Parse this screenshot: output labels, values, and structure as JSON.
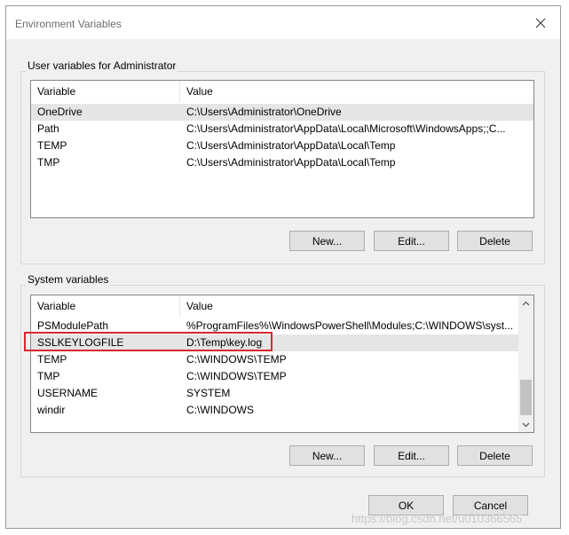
{
  "window": {
    "title": "Environment Variables"
  },
  "user_section": {
    "title": "User variables for Administrator",
    "columns": [
      "Variable",
      "Value"
    ],
    "rows": [
      [
        "OneDrive",
        "C:\\Users\\Administrator\\OneDrive"
      ],
      [
        "Path",
        "C:\\Users\\Administrator\\AppData\\Local\\Microsoft\\WindowsApps;;C..."
      ],
      [
        "TEMP",
        "C:\\Users\\Administrator\\AppData\\Local\\Temp"
      ],
      [
        "TMP",
        "C:\\Users\\Administrator\\AppData\\Local\\Temp"
      ]
    ],
    "buttons": {
      "new": "New...",
      "edit": "Edit...",
      "delete": "Delete"
    }
  },
  "system_section": {
    "title": "System variables",
    "columns": [
      "Variable",
      "Value"
    ],
    "rows": [
      [
        "PSModulePath",
        "%ProgramFiles%\\WindowsPowerShell\\Modules;C:\\WINDOWS\\syst..."
      ],
      [
        "SSLKEYLOGFILE",
        "D:\\Temp\\key.log"
      ],
      [
        "TEMP",
        "C:\\WINDOWS\\TEMP"
      ],
      [
        "TMP",
        "C:\\WINDOWS\\TEMP"
      ],
      [
        "USERNAME",
        "SYSTEM"
      ],
      [
        "windir",
        "C:\\WINDOWS"
      ]
    ],
    "buttons": {
      "new": "New...",
      "edit": "Edit...",
      "delete": "Delete"
    }
  },
  "footer": {
    "ok": "OK",
    "cancel": "Cancel"
  },
  "watermark": "https://blog.csdn.net/u010366565"
}
